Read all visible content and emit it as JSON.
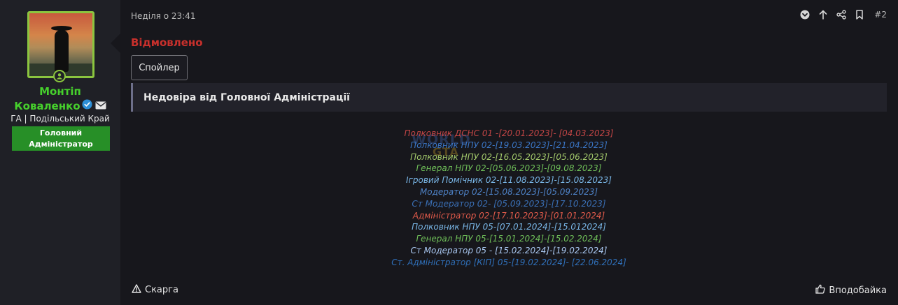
{
  "author": {
    "name_line1": "Монтіп",
    "name_line2": "Коваленко",
    "title": "ГА | Подільський Край",
    "banner": "Головний Адміністратор"
  },
  "post": {
    "date": "Неділя о 23:41",
    "number": "#2",
    "status": "Відмовлено",
    "spoiler_label": "Спойлер",
    "quote_title": "Недовіра від Головної Адміністрації",
    "watermark": "WORLD",
    "watermark_sub": "GTA",
    "history": [
      {
        "text": "Полковник ДСНС 01 -[20.01.2023]- [04.03.2023]",
        "color": "#c24545"
      },
      {
        "text": "Полковник НПУ 02-[19.03.2023]-[21.04.2023]",
        "color": "#3a75c4"
      },
      {
        "text": "Полковник НПУ 02-[16.05.2023]-[05.06.2023]",
        "color": "#a3c96b"
      },
      {
        "text": "Генерал НПУ 02-[05.06.2023]-[09.08.2023]",
        "color": "#6fbf59"
      },
      {
        "text": "Ігровий Помічник 02-[11.08.2023]-[15.08.2023]",
        "color": "#79b6e6"
      },
      {
        "text": "Модератор 02-[15.08.2023]-[05.09.2023]",
        "color": "#4e82c6"
      },
      {
        "text": "Ст Модератор 02- [05.09.2023]-[17.10.2023]",
        "color": "#3a6fb5"
      },
      {
        "text": "Адміністратор 02-[17.10.2023]-[01.01.2024]",
        "color": "#e05a4a"
      },
      {
        "text": "Полковник НПУ 05-[07.01.2024]-[15.012024]",
        "color": "#79b6e6"
      },
      {
        "text": "Генерал НПУ 05-[15.01.2024]-[15.02.2024]",
        "color": "#6fbf59"
      },
      {
        "text": "Ст Модератор 05 - [15.02.2024]-[19.02.2024]",
        "color": "#a9c7f0"
      },
      {
        "text": "Ст. Адміністратор [КІП] 05-[19.02.2024]- [22.06.2024]",
        "color": "#2f6fb8"
      }
    ]
  },
  "footer": {
    "report_label": "Скарга",
    "like_label": "Вподобайка"
  },
  "icons": {
    "online": "user-online-icon",
    "verified": "verified-check-icon",
    "message": "envelope-icon",
    "bookmark": "bookmark-icon",
    "share": "share-icon",
    "up": "arrow-up-icon",
    "down": "chevron-down-circle-icon",
    "report": "warning-triangle-icon",
    "like": "thumbs-up-icon"
  }
}
